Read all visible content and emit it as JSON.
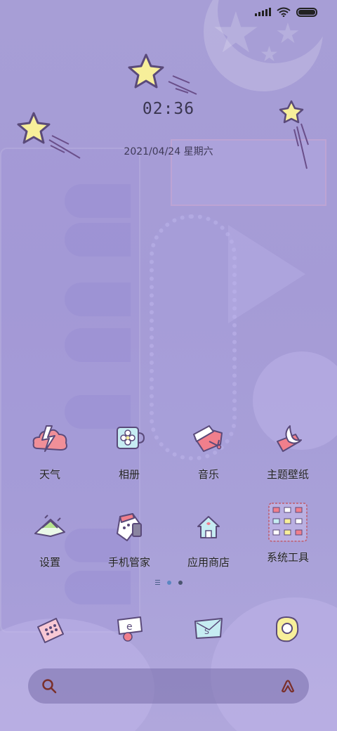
{
  "status_bar": {
    "signal_icon": "cellular-signal-icon",
    "wifi_icon": "wifi-icon",
    "battery_icon": "battery-icon",
    "battery_level": 1.0
  },
  "clock": {
    "time": "02:36"
  },
  "date": {
    "text": "2021/04/24 星期六"
  },
  "apps_row1": [
    {
      "label": "天气",
      "icon": "weather-icon"
    },
    {
      "label": "相册",
      "icon": "gallery-icon"
    },
    {
      "label": "音乐",
      "icon": "music-icon"
    },
    {
      "label": "主题壁纸",
      "icon": "themes-icon"
    }
  ],
  "apps_row2": [
    {
      "label": "设置",
      "icon": "settings-icon"
    },
    {
      "label": "手机管家",
      "icon": "security-icon"
    },
    {
      "label": "应用商店",
      "icon": "app-store-icon"
    },
    {
      "label": "系统工具",
      "icon": "system-tools-folder-icon"
    }
  ],
  "dock": [
    {
      "icon": "phone-dialer-icon"
    },
    {
      "icon": "browser-icon"
    },
    {
      "icon": "messages-icon"
    },
    {
      "icon": "camera-icon"
    }
  ],
  "pager": {
    "pages": 3,
    "active": 1
  },
  "search_bar": {
    "left_icon": "search-icon",
    "right_icon": "assistant-icon"
  },
  "colors": {
    "background": "#a79ed6",
    "star_fill": "#f7ef9a",
    "star_stroke": "#5a4a7a",
    "pink": "#f07f8c",
    "text": "#222222"
  }
}
